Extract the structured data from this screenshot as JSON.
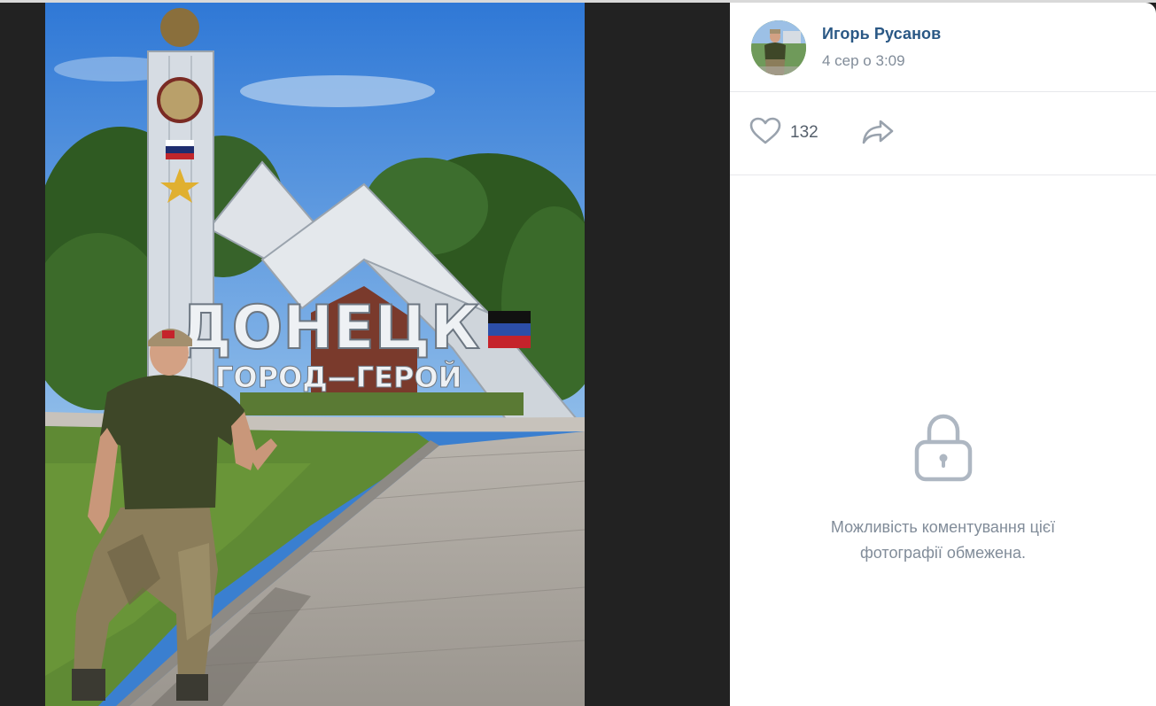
{
  "post": {
    "author_name": "Игорь Русанов",
    "date": "4 сер о 3:09"
  },
  "actions": {
    "like_count": "132"
  },
  "comments": {
    "restricted_text": "Можливість коментування цієї фотографії обмежена."
  },
  "photo": {
    "sign_title": "ДОНЕЦК",
    "sign_subtitle": "ГОРОД—ГЕРОЙ"
  },
  "colors": {
    "link": "#2a5885",
    "secondary": "#818c99",
    "icon": "#99a2ad",
    "divider": "#e7e8ec"
  },
  "icons": [
    "heart-icon",
    "share-icon",
    "lock-icon"
  ]
}
